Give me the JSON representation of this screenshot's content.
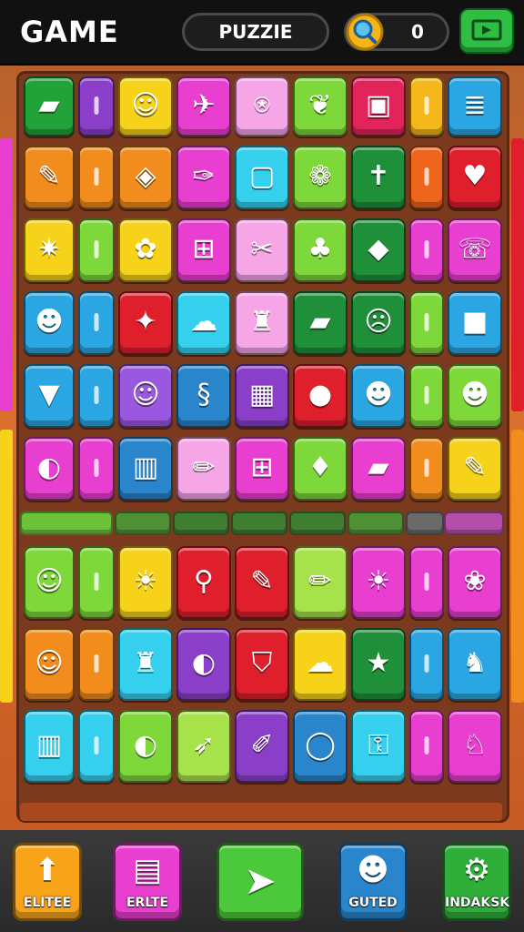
{
  "header": {
    "title": "GAME",
    "mode_label": "PUZZIE",
    "score": "0",
    "score_icon": "magnifier-coin-icon",
    "top_button_icon": "screen-arrow-icon"
  },
  "board": {
    "rows": [
      [
        "#22a33a",
        "#8b3fc9",
        "#f7d21a",
        "#e93fd0",
        "#f6a6e6",
        "#7fd83a",
        "#e2245a",
        "#f5b719",
        "#2aa7e2"
      ],
      [
        "#f28c1c",
        "#f28c1c",
        "#f28c1c",
        "#e93fd0",
        "#35d0ee",
        "#7fd83a",
        "#1f8f3a",
        "#f0651c",
        "#e01f2c"
      ],
      [
        "#f7d21a",
        "#7fd83a",
        "#f7d21a",
        "#e93fd0",
        "#f6a6e6",
        "#7fd83a",
        "#1f8f3a",
        "#e93fd0",
        "#e93fd0"
      ],
      [
        "#2aa7e2",
        "#2aa7e2",
        "#e01f2c",
        "#35d0ee",
        "#f6a6e6",
        "#1f8f3a",
        "#1f8f3a",
        "#7fd83a",
        "#2aa7e2"
      ],
      [
        "#2aa7e2",
        "#2aa7e2",
        "#9a58e0",
        "#2a86cc",
        "#8b3fc9",
        "#e01f2c",
        "#2aa7e2",
        "#7fd83a",
        "#7fd83a"
      ],
      [
        "#e93fd0",
        "#e93fd0",
        "#2a86cc",
        "#f6a6e6",
        "#e93fd0",
        "#7fd83a",
        "#e93fd0",
        "#f28c1c",
        "#f7d21a"
      ],
      [
        "#7fd83a",
        "#7fd83a",
        "#f7d21a",
        "#e01f2c",
        "#e01f2c",
        "#a8e24a",
        "#e93fd0",
        "#e93fd0",
        "#e93fd0"
      ],
      [
        "#f28c1c",
        "#f28c1c",
        "#35d0ee",
        "#8b3fc9",
        "#e01f2c",
        "#f7d21a",
        "#1f8f3a",
        "#2aa7e2",
        "#2aa7e2"
      ],
      [
        "#35d0ee",
        "#35d0ee",
        "#7fd83a",
        "#a8e24a",
        "#8b3fc9",
        "#2a86cc",
        "#35d0ee",
        "#e93fd0",
        "#e93fd0"
      ]
    ],
    "icons": [
      [
        "card-icon",
        "",
        "cat-face-icon",
        "bird-icon",
        "robot-icon",
        "leaf-icon",
        "cake-icon",
        "",
        "stack-icon"
      ],
      [
        "pen-icon",
        "",
        "tag-icon",
        "feather-icon",
        "box-icon",
        "pumpkin-icon",
        "cross-icon",
        "",
        "heart-icon"
      ],
      [
        "fish-icon",
        "",
        "flower-icon",
        "basket-icon",
        "scissors-icon",
        "tree-icon",
        "crystal-icon",
        "",
        "phone-icon"
      ],
      [
        "dog-face-icon",
        "",
        "bat-icon",
        "ghost-icon",
        "jar-icon",
        "card-icon",
        "skull-icon",
        "",
        "toast-icon"
      ],
      [
        "ice-cream-icon",
        "",
        "bear-icon",
        "swirl-icon",
        "window-icon",
        "apple-icon",
        "dog-face-icon",
        "",
        "monster-icon"
      ],
      [
        "ball-icon",
        "",
        "building-icon",
        "pencil-icon",
        "basket-icon",
        "candy-icon",
        "card-icon",
        "",
        "pen-icon"
      ],
      [
        "wolf-face-icon",
        "",
        "lion-face-icon",
        "magnifier-icon",
        "pen-icon",
        "pencil-icon",
        "lion-face-icon",
        "",
        "sheep-icon"
      ],
      [
        "face-icon",
        "",
        "bin-icon",
        "ball-icon",
        "shield-icon",
        "ghost-icon",
        "star-icon",
        "",
        "deer-icon"
      ],
      [
        "building-icon",
        "",
        "ball-icon",
        "rocket-icon",
        "crayon-icon",
        "ring-icon",
        "lock-icon",
        "",
        "fox-icon"
      ]
    ],
    "divider_colors": [
      "#6cc33a",
      "#4f8f35",
      "#3f7d33",
      "#3f7d33",
      "#3f7d33",
      "#4f8f35",
      "#6a6a6a",
      "#b24fa8"
    ]
  },
  "bottom_bar": {
    "buttons": [
      {
        "label": "ELITEE",
        "color": "#f7a41a",
        "icon": "arrow-up-icon"
      },
      {
        "label": "ERLTE",
        "color": "#e93fd0",
        "icon": "cards-icon"
      },
      {
        "label": "",
        "color": "#4cc93a",
        "icon": "paper-plane-icon"
      },
      {
        "label": "GUTED",
        "color": "#2a86cc",
        "icon": "bear-face-icon"
      },
      {
        "label": "INDAKSK",
        "color": "#2fae3a",
        "icon": "gear-icon"
      }
    ]
  }
}
